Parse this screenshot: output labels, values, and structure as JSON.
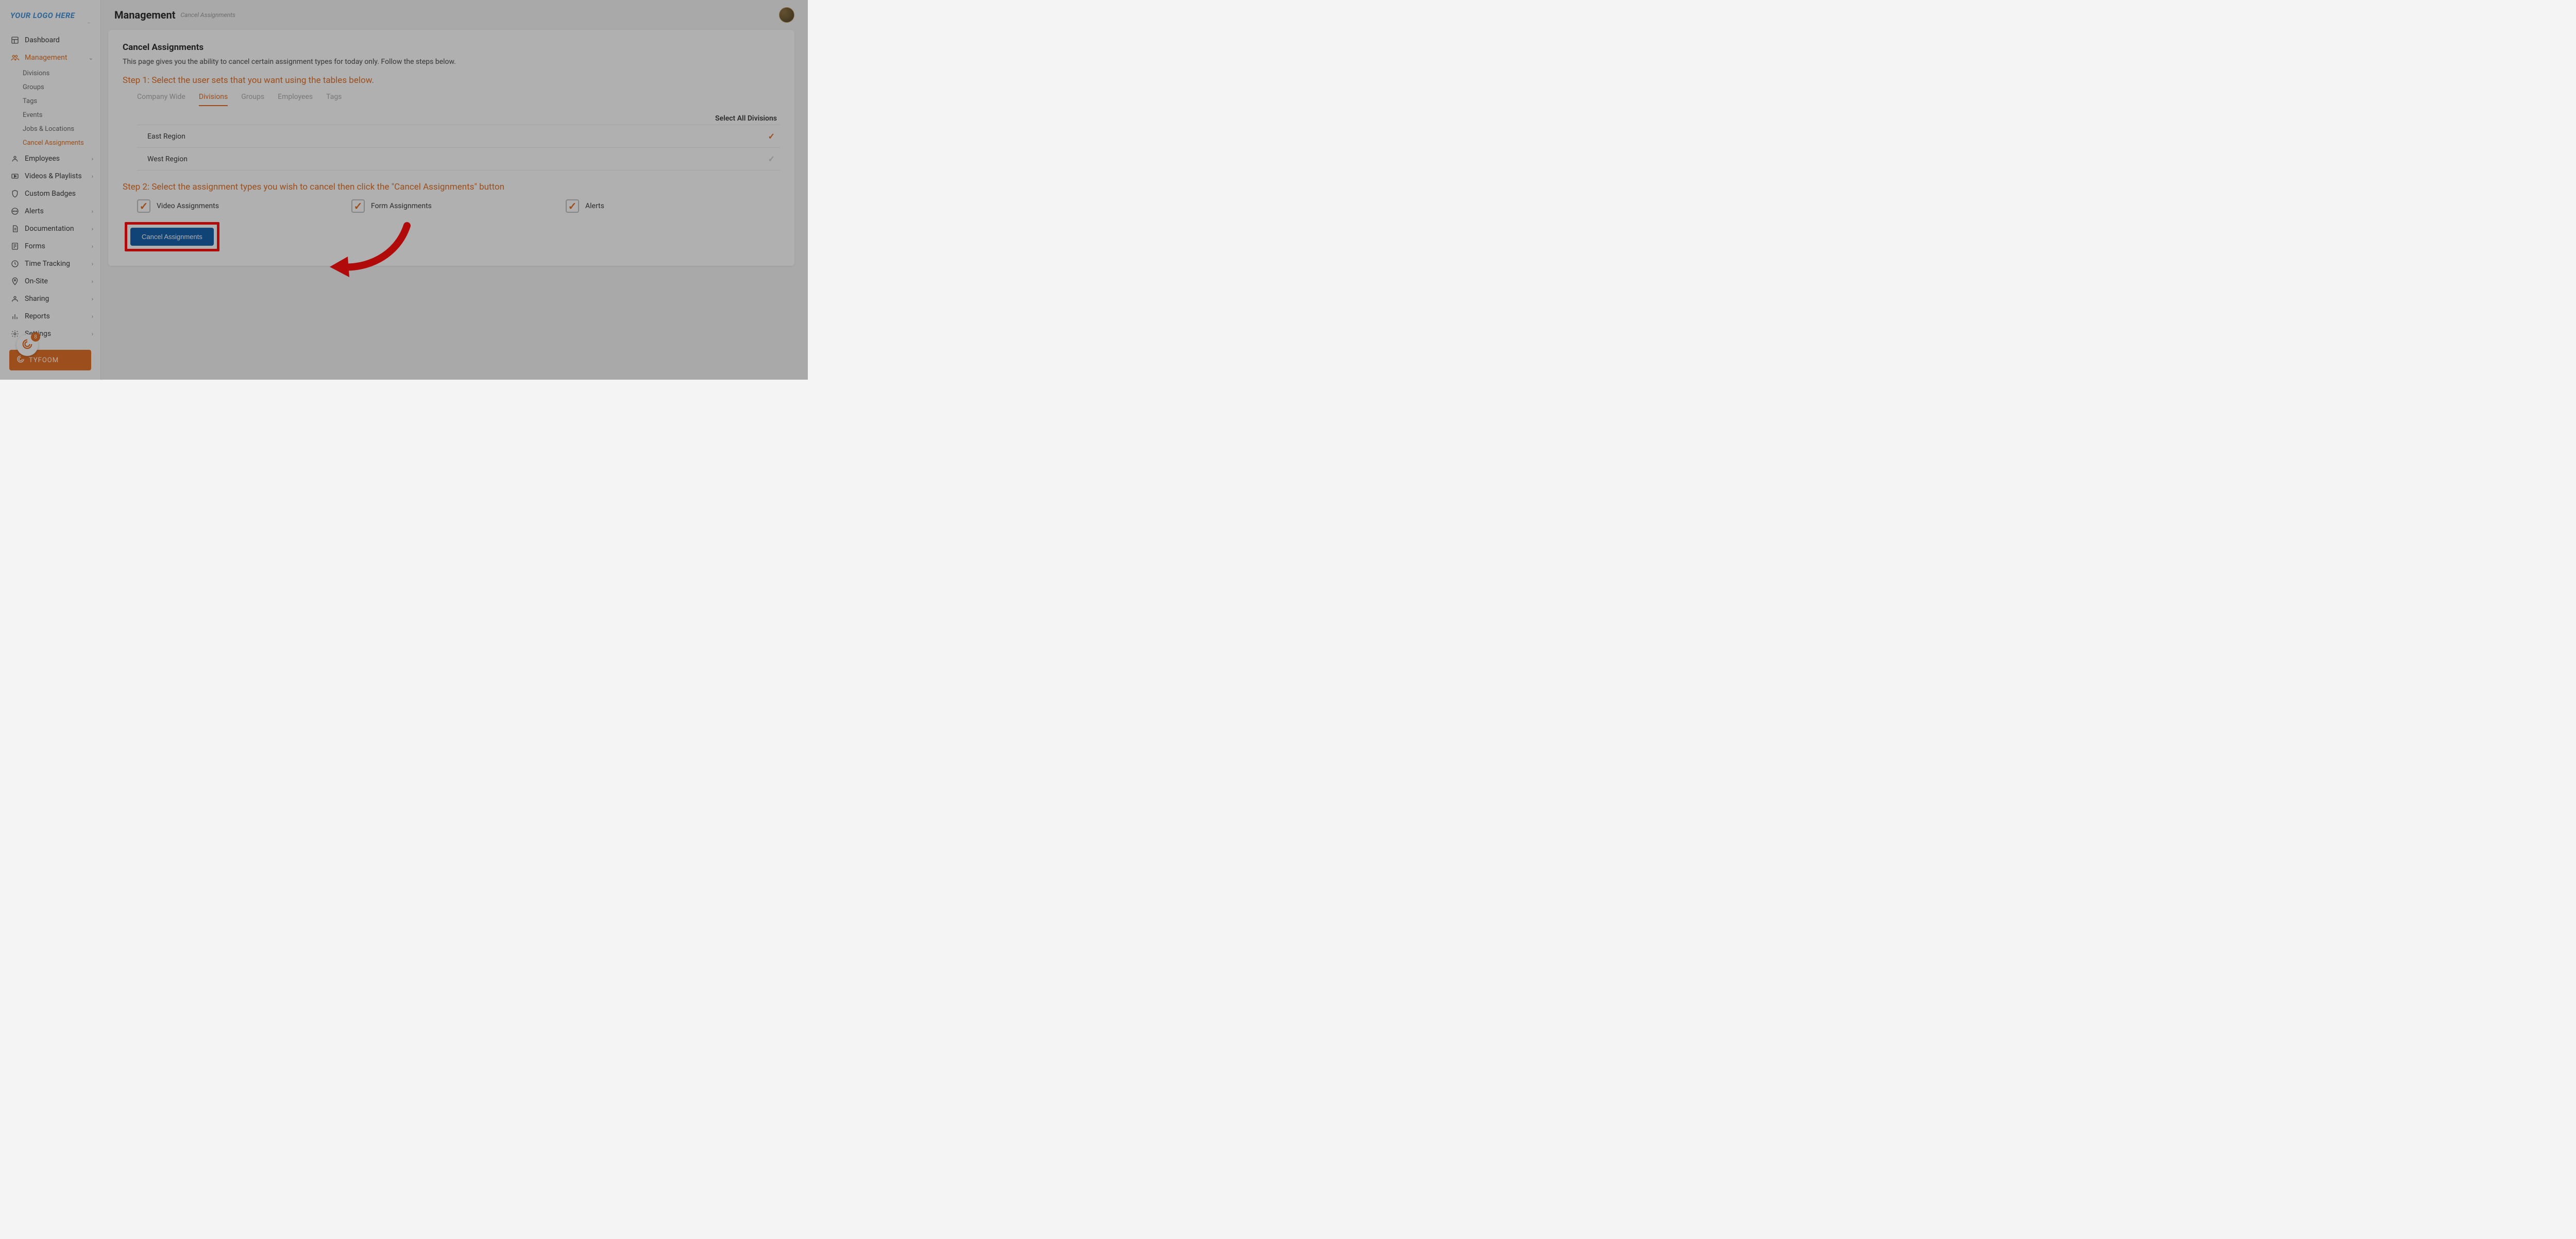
{
  "logo": {
    "text": "YOUR LOGO HERE",
    "sub": "—"
  },
  "header": {
    "title": "Management",
    "breadcrumb": "Cancel Assignments"
  },
  "sidebar": {
    "items": [
      {
        "label": "Dashboard"
      },
      {
        "label": "Management",
        "active": true
      },
      {
        "label": "Employees"
      },
      {
        "label": "Videos & Playlists"
      },
      {
        "label": "Custom Badges"
      },
      {
        "label": "Alerts"
      },
      {
        "label": "Documentation"
      },
      {
        "label": "Forms"
      },
      {
        "label": "Time Tracking"
      },
      {
        "label": "On-Site"
      },
      {
        "label": "Sharing"
      },
      {
        "label": "Reports"
      },
      {
        "label": "Settings"
      }
    ],
    "sub": [
      {
        "label": "Divisions"
      },
      {
        "label": "Groups"
      },
      {
        "label": "Tags"
      },
      {
        "label": "Events"
      },
      {
        "label": "Jobs & Locations"
      },
      {
        "label": "Cancel Assignments",
        "active": true
      }
    ]
  },
  "badge_count": "8",
  "brand_bar": "TYFOOM",
  "card": {
    "title": "Cancel Assignments",
    "desc": "This page gives you the ability to cancel certain assignment types for today only. Follow the steps below.",
    "step1": "Step 1: Select the user sets that you want using the tables below.",
    "step2": "Step 2: Select the assignment types you wish to cancel then click the \"Cancel Assignments\" button",
    "tabs": [
      "Company Wide",
      "Divisions",
      "Groups",
      "Employees",
      "Tags"
    ],
    "select_all": "Select All Divisions",
    "rows": [
      {
        "name": "East Region",
        "checked": true
      },
      {
        "name": "West Region",
        "checked": false
      }
    ],
    "checks": [
      {
        "label": "Video Assignments"
      },
      {
        "label": "Form Assignments"
      },
      {
        "label": "Alerts"
      }
    ],
    "button": "Cancel Assignments"
  }
}
